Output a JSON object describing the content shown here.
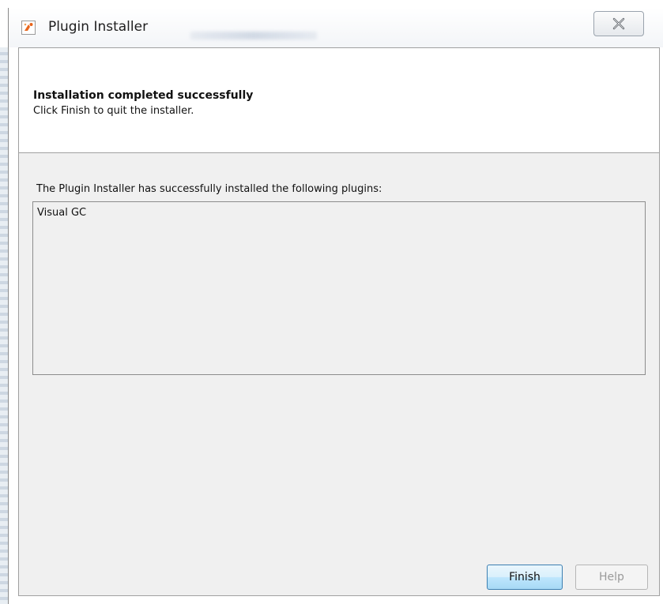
{
  "window": {
    "title": "Plugin Installer"
  },
  "header": {
    "title": "Installation completed successfully",
    "subtitle": "Click Finish to quit the installer."
  },
  "content": {
    "message": "The Plugin Installer has successfully installed the following plugins:",
    "plugins": [
      "Visual GC"
    ]
  },
  "buttons": {
    "finish_label": "Finish",
    "help_label": "Help"
  },
  "colors": {
    "accent_border": "#3c7fb1",
    "panel_bg": "#f0f0f0",
    "disabled_text": "#9a9a9a"
  },
  "icons": {
    "app": "netbeans-plugin-icon",
    "close": "close-icon"
  }
}
